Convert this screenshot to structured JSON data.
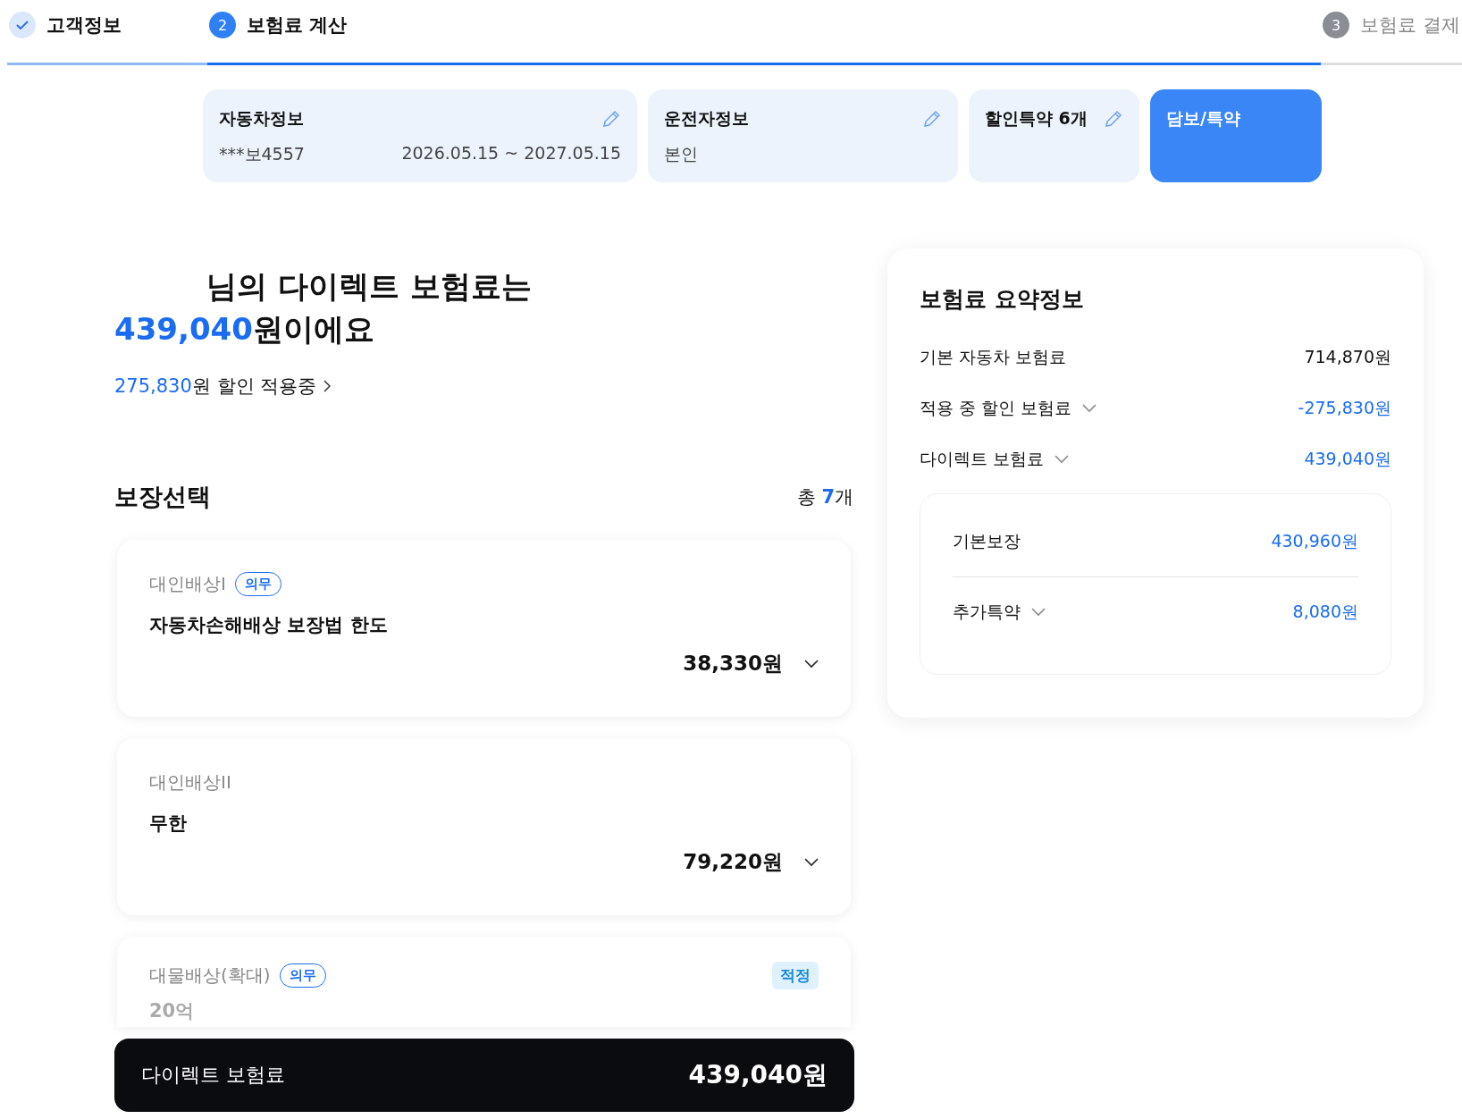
{
  "steps": [
    {
      "label": "고객정보",
      "completed": true,
      "selected": false
    },
    {
      "number": "2",
      "label": "보험료 계산",
      "completed": false,
      "selected": true
    },
    {
      "number": "3",
      "label": "보험료 결제",
      "completed": false,
      "selected": false
    }
  ],
  "info_cards": [
    {
      "title": "자동차정보",
      "lines": [
        "***보4557",
        "2026.05.15 ~ 2027.05.15"
      ],
      "editable": true,
      "selected": false
    },
    {
      "title": "운전자정보",
      "lines": [
        "본인"
      ],
      "editable": true,
      "selected": false
    },
    {
      "title": "할인특약 6개",
      "editable": true,
      "selected": false
    },
    {
      "title": "담보/특약",
      "editable": false,
      "selected": true
    }
  ],
  "headline": {
    "line1": "님의 다이렉트 보험료는",
    "amount": "439,040",
    "suffix": "원이에요"
  },
  "discount_link": {
    "amount": "275,830",
    "text": "원 할인 적용중"
  },
  "coverage": {
    "title": "보장선택",
    "count_prefix": "총",
    "count": "7",
    "count_suffix": "개",
    "items": [
      {
        "category": "대인배상I",
        "badge": "의무",
        "limit": "자동차손해배상 보장법 한도",
        "price": "38,330원",
        "expanded": false
      },
      {
        "category": "대인배상II",
        "limit": "무한",
        "price": "79,220원",
        "expanded": false
      },
      {
        "category": "대물배상(확대)",
        "badge": "의무",
        "tag": "적정",
        "limit": "20억"
      }
    ]
  },
  "summary": {
    "title": "보험료 요약정보",
    "rows": [
      {
        "label": "기본 자동차 보험료",
        "value": "714,870원",
        "accent": false
      },
      {
        "label": "적용 중 할인 보험료",
        "value": "-275,830원",
        "accent": true,
        "expanded": false
      },
      {
        "label": "다이렉트 보험료",
        "value": "439,040원",
        "accent": true,
        "expanded": false
      }
    ],
    "breakdown": [
      {
        "label": "기본보장",
        "value": "430,960원",
        "accent": true
      },
      {
        "label": "추가특약",
        "value": "8,080원",
        "accent": true,
        "expanded": false
      }
    ]
  },
  "bottom_bar": {
    "label": "다이렉트 보험료",
    "amount": "439,040원"
  }
}
